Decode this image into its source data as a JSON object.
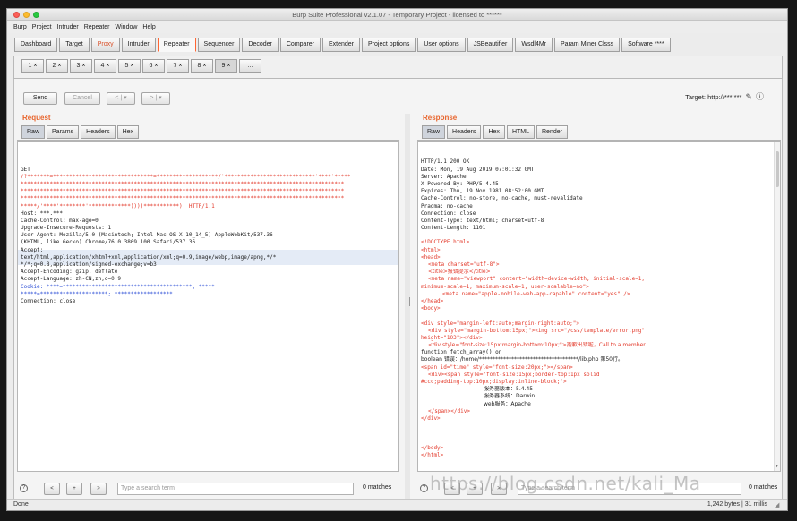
{
  "window": {
    "title": "Burp Suite Professional v2.1.07 - Temporary Project - licensed to ******"
  },
  "menubar": [
    "Burp",
    "Project",
    "Intruder",
    "Repeater",
    "Window",
    "Help"
  ],
  "main_tabs": [
    "Dashboard",
    "Target",
    "Proxy",
    "Intruder",
    "Repeater",
    "Sequencer",
    "Decoder",
    "Comparer",
    "Extender",
    "Project options",
    "User options",
    "JSBeautifier",
    "Wsdl4Mr",
    "Param Miner Clsss",
    "Software ****"
  ],
  "repeater_tabs": [
    "1",
    "2",
    "3",
    "4",
    "5",
    "6",
    "7",
    "8",
    "9",
    "..."
  ],
  "toolbar": {
    "send": "Send",
    "cancel": "Cancel",
    "back": "< | ▾",
    "forward": "> | ▾",
    "target_label": "Target: http://***.***"
  },
  "request": {
    "heading": "Request",
    "tabs": [
      "Raw",
      "Params",
      "Headers",
      "Hex"
    ],
    "lines": [
      {
        "t": "GET",
        "c": "dk"
      },
      {
        "t": "/?*******=*******************************=*******************/'****************************'****'*****",
        "c": "red"
      },
      {
        "t": "****************************************************************************************************",
        "c": "red"
      },
      {
        "t": "****************************************************************************************************",
        "c": "red"
      },
      {
        "t": "****************************************************************************************************",
        "c": "red"
      },
      {
        "t": "*****/'****'********'*************))))***********)  HTTP/1.1",
        "c": "red"
      },
      {
        "t": "Host: ***.***",
        "c": "dk"
      },
      {
        "t": "Cache-Control: max-age=0",
        "c": "dk"
      },
      {
        "t": "Upgrade-Insecure-Requests: 1",
        "c": "dk"
      },
      {
        "t": "User-Agent: Mozilla/5.0 (Macintosh; Intel Mac OS X 10_14_5) AppleWebKit/537.36",
        "c": "dk"
      },
      {
        "t": "(KHTML, like Gecko) Chrome/76.0.3809.100 Safari/537.36",
        "c": "dk"
      },
      {
        "t": "Accept:",
        "c": "dk"
      },
      {
        "t": "text/html,application/xhtml+xml,application/xml;q=0.9,image/webp,image/apng,*/*",
        "c": "dk"
      },
      {
        "t": "*/*;q=0.8,application/signed-exchange;v=b3",
        "c": "dk"
      },
      {
        "t": "Accept-Encoding: gzip, deflate",
        "c": "dk"
      },
      {
        "t": "Accept-Language: zh-CN,zh;q=0.9",
        "c": "dk"
      },
      {
        "t": "Cookie: ****=****************************************; *****",
        "c": "blue"
      },
      {
        "t": "*****=*********************; ******************",
        "c": "blue"
      },
      {
        "t": "Connection: close",
        "c": "dk"
      }
    ]
  },
  "response": {
    "heading": "Response",
    "tabs": [
      "Raw",
      "Headers",
      "Hex",
      "HTML",
      "Render"
    ],
    "lines": [
      {
        "t": "HTTP/1.1 200 OK",
        "c": "dk",
        "i": 0
      },
      {
        "t": "Date: Mon, 19 Aug 2019 07:01:32 GMT",
        "c": "dk",
        "i": 0
      },
      {
        "t": "Server: Apache",
        "c": "dk",
        "i": 0
      },
      {
        "t": "X-Powered-By: PHP/5.4.45",
        "c": "dk",
        "i": 0
      },
      {
        "t": "Expires: Thu, 19 Nov 1981 08:52:00 GMT",
        "c": "dk",
        "i": 0
      },
      {
        "t": "Cache-Control: no-store, no-cache, must-revalidate",
        "c": "dk",
        "i": 0
      },
      {
        "t": "Pragma: no-cache",
        "c": "dk",
        "i": 0
      },
      {
        "t": "Connection: close",
        "c": "dk",
        "i": 0
      },
      {
        "t": "Content-Type: text/html; charset=utf-8",
        "c": "dk",
        "i": 0
      },
      {
        "t": "Content-Length: 1101",
        "c": "dk",
        "i": 0
      },
      {
        "t": "",
        "c": "dk",
        "i": 0
      },
      {
        "t": "<!DOCTYPE html>",
        "c": "red",
        "i": 0
      },
      {
        "t": "<html>",
        "c": "red",
        "i": 0
      },
      {
        "t": "<head>",
        "c": "red",
        "i": 0
      },
      {
        "t": "<meta charset=\"utf-8\">",
        "c": "red",
        "i": 1
      },
      {
        "t": "<title>报错提示</title>",
        "c": "red",
        "i": 1
      },
      {
        "t": "<meta name=\"viewport\" content=\"width=device-width, initial-scale=1,",
        "c": "red",
        "i": 1
      },
      {
        "t": "minimum-scale=1, maximum-scale=1, user-scalable=no\">",
        "c": "red",
        "i": 0
      },
      {
        "t": "<meta name=\"apple-mobile-web-app-capable\" content=\"yes\" />",
        "c": "red",
        "i": 2
      },
      {
        "t": "</head>",
        "c": "red",
        "i": 0
      },
      {
        "t": "<body>",
        "c": "red",
        "i": 0
      },
      {
        "t": "",
        "c": "dk",
        "i": 0
      },
      {
        "t": "<div style=\"margin-left:auto;margin-right:auto;\">",
        "c": "red",
        "i": 0
      },
      {
        "t": "<div style=\"margin-bottom:15px;\"><img src=\"/css/template/error.png\"",
        "c": "red",
        "i": 1
      },
      {
        "t": "height=\"103\"></div>",
        "c": "red",
        "i": 0
      },
      {
        "t": "<div style=\"font-size:15px;margin-bottom:10px;\">抱歉出错啦，Call to a member",
        "c": "red",
        "i": 1
      },
      {
        "t": "function fetch_array() on",
        "c": "dk",
        "i": 0
      },
      {
        "t": "boolean 错误：/home/*************************************/lib.php 第50行。",
        "c": "dk",
        "i": 0
      },
      {
        "t": "<span id=\"time\" style=\"font-size:20px;\"></span>",
        "c": "red",
        "i": 0
      },
      {
        "t": "<div><span style=\"font-size:15px;border-top:1px solid",
        "c": "red",
        "i": 1
      },
      {
        "t": "#ccc;padding-top:10px;display:inline-block;\">",
        "c": "red",
        "i": 0
      },
      {
        "t": "服务器版本：5.4.45",
        "c": "dk",
        "i": 5
      },
      {
        "t": "服务器系统：Darwin",
        "c": "dk",
        "i": 5
      },
      {
        "t": "web服务：Apache",
        "c": "dk",
        "i": 5
      },
      {
        "t": "</span></div>",
        "c": "red",
        "i": 1
      },
      {
        "t": "</div>",
        "c": "red",
        "i": 0
      },
      {
        "t": "",
        "c": "dk",
        "i": 0
      },
      {
        "t": "",
        "c": "dk",
        "i": 0
      },
      {
        "t": "",
        "c": "dk",
        "i": 0
      },
      {
        "t": "</body>",
        "c": "red",
        "i": 0
      },
      {
        "t": "</html>",
        "c": "red",
        "i": 0
      }
    ]
  },
  "search_left": {
    "placeholder": "Type a search term",
    "matches": "0 matches"
  },
  "search_right": {
    "placeholder": "Type a search term",
    "matches": "0 matches"
  },
  "status": {
    "left": "Done",
    "right": "1,242 bytes | 31 millis"
  },
  "watermark": "https://blog.csdn.net/kali_Ma"
}
